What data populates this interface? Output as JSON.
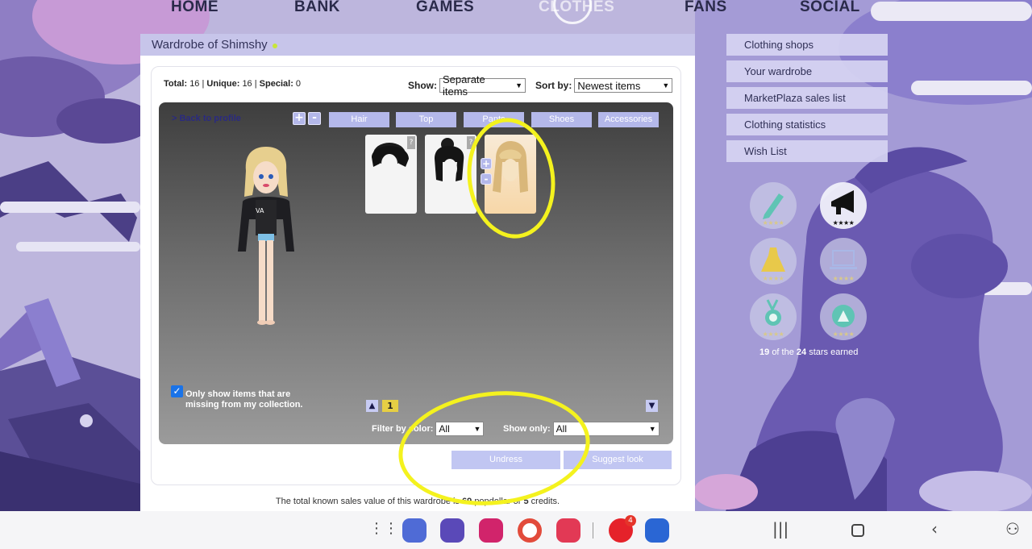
{
  "nav": {
    "home": "HOME",
    "bank": "BANK",
    "games": "GAMES",
    "clothes": "CLOTHES",
    "fans": "FANS",
    "social": "SOCIAL"
  },
  "panel": {
    "title": "Wardrobe of Shimshy",
    "stats": {
      "total_label": "Total:",
      "total_value": "16",
      "unique_label": "Unique:",
      "unique_value": "16",
      "special_label": "Special:",
      "special_value": "0",
      "separator": "|"
    },
    "show_label": "Show:",
    "show_value": "Separate items",
    "sort_label": "Sort by:",
    "sort_value": "Newest items",
    "back_link": "> Back to profile",
    "zoom_in": "+",
    "zoom_out": "-",
    "tabs": [
      "Hair",
      "Top",
      "Pants",
      "Shoes",
      "Accessories"
    ],
    "missing_checkbox_label": "Only show items that are missing from my collection.",
    "page_number": "1",
    "filter_color_label": "Filter by color:",
    "filter_color_value": "All",
    "show_only_label": "Show only:",
    "show_only_value": "All",
    "undress_button": "Undress",
    "suggest_button": "Suggest look",
    "footer_text_1": "The total known sales value of this wardrobe is",
    "footer_popdollar_value": "69",
    "footer_text_2": "popdollar or",
    "footer_credits_value": "5",
    "footer_text_3": "credits."
  },
  "sidebar": {
    "items": [
      "Clothing shops",
      "Your wardrobe",
      "MarketPlaza sales list",
      "Clothing statistics",
      "Wish List"
    ]
  },
  "badges": {
    "stars_earned_value": "19",
    "stars_of": "of the",
    "stars_total_value": "24",
    "stars_suffix": "stars earned",
    "star_glyphs": "★★★★",
    "items": [
      {
        "icon": "pencil-icon",
        "stars_earned": 0
      },
      {
        "icon": "megaphone-icon",
        "stars_earned": 4
      },
      {
        "icon": "dress-icon",
        "stars_earned": 3
      },
      {
        "icon": "laptop-icon",
        "stars_earned": 0
      },
      {
        "icon": "medal-icon",
        "stars_earned": 0
      },
      {
        "icon": "compass-icon",
        "stars_earned": 0
      }
    ]
  },
  "taskbar": {
    "opera_badge": "4"
  },
  "colors": {
    "accent": "#b4b8ea",
    "annotation": "#f4f21e",
    "page_highlight": "#e6cf44"
  }
}
